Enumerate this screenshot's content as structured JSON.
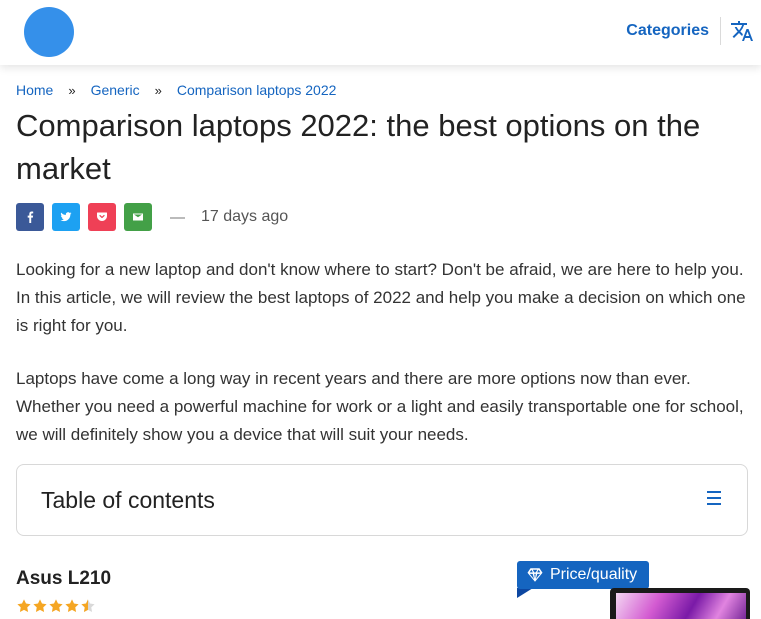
{
  "header": {
    "categories_label": "Categories",
    "translate_icon": "translate-icon",
    "brand_color": "#3590ea",
    "accent_color": "#1565c0"
  },
  "breadcrumb": {
    "items": [
      "Home",
      "Generic",
      "Comparison laptops 2022"
    ],
    "separator": "»"
  },
  "article": {
    "title": "Comparison laptops 2022: the best options on the market",
    "dash": "—",
    "date": "17 days ago",
    "share": [
      {
        "name": "facebook",
        "icon": "facebook-icon",
        "color": "#3b5998"
      },
      {
        "name": "twitter",
        "icon": "twitter-icon",
        "color": "#1da1f2"
      },
      {
        "name": "pocket",
        "icon": "pocket-icon",
        "color": "#ef4056"
      },
      {
        "name": "email",
        "icon": "email-icon",
        "color": "#43a047"
      }
    ],
    "paragraphs": [
      "Looking for a new laptop and don't know where to start? Don't be afraid, we are here to help you. In this article, we will review the best laptops of 2022 and help you make a decision on which one is right for you.",
      "Laptops have come a long way in recent years and there are more options now than ever. Whether you need a powerful machine for work or a light and easily transportable one for school, we will definitely show you a device that will suit your needs."
    ]
  },
  "toc": {
    "title": "Table of contents",
    "icon": "menu-icon"
  },
  "product": {
    "name": "Asus L210",
    "rating": 4.5,
    "rating_max": 5,
    "star_color": "#f5a623",
    "badge_label": "Price/quality",
    "badge_icon": "diamond-icon"
  }
}
